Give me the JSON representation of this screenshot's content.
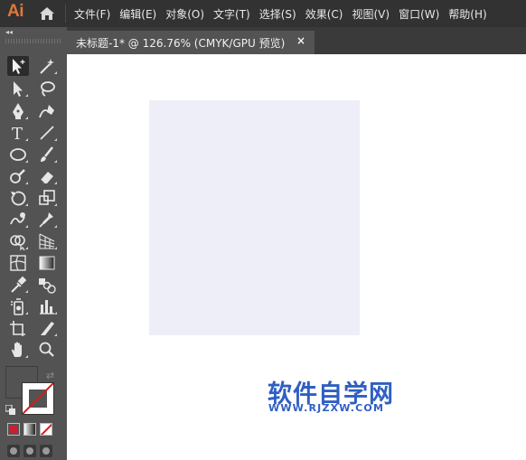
{
  "app": {
    "logo_text": "Ai",
    "home_icon": "home-icon"
  },
  "menu": [
    "文件(F)",
    "编辑(E)",
    "对象(O)",
    "文字(T)",
    "选择(S)",
    "效果(C)",
    "视图(V)",
    "窗口(W)",
    "帮助(H)"
  ],
  "toolbar": {
    "collapse_label": "◂◂",
    "tools": [
      "selection-tool-icon",
      "magic-wand-icon",
      "direct-selection-icon",
      "lasso-icon",
      "pen-icon",
      "curvature-icon",
      "type-icon",
      "line-segment-icon",
      "ellipse-icon",
      "paintbrush-icon",
      "blob-brush-icon",
      "eraser-icon",
      "rotate-icon",
      "scale-icon",
      "warp-icon",
      "puppet-warp-icon",
      "shape-builder-icon",
      "perspective-grid-icon",
      "mesh-icon",
      "gradient-icon",
      "eyedropper-icon",
      "blend-icon",
      "symbol-sprayer-icon",
      "column-graph-icon",
      "artboard-icon",
      "slice-icon",
      "hand-icon",
      "zoom-icon"
    ],
    "type_glyph": "T",
    "swap_glyph": "⇄"
  },
  "document_tab": {
    "title": "未标题-1* @ 126.76% (CMYK/GPU 预览)",
    "close_label": "×"
  },
  "canvas": {
    "rectangle_fill": "#EEEEF8"
  },
  "watermark": {
    "title": "软件自学网",
    "url": "WWW.RJZXW.COM"
  },
  "colors": {
    "accent_logo": "#E0773A",
    "watermark": "#2F5FC2",
    "none_swatch_slash": "#D01C1C"
  }
}
